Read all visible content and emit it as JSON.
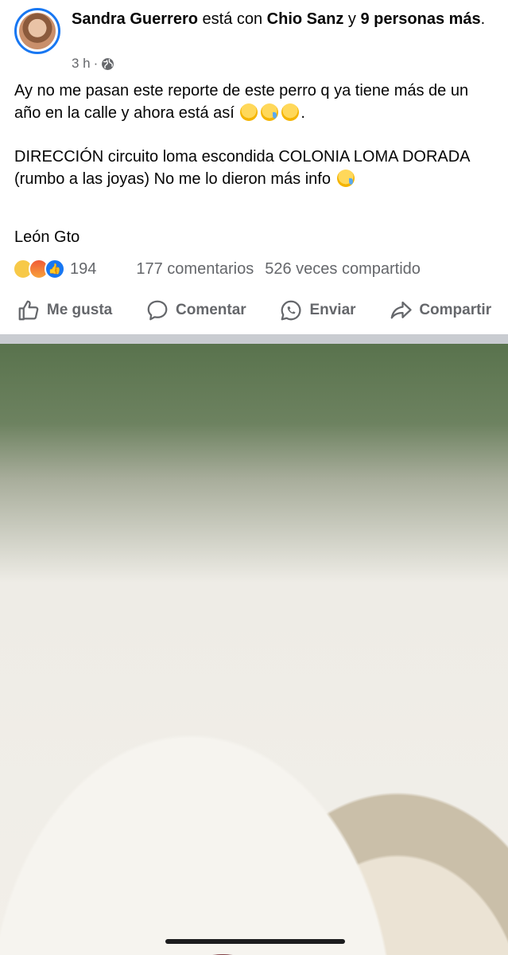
{
  "post": {
    "author": "Sandra Guerrero",
    "with_text": " está con ",
    "tagged": "Chio Sanz",
    "and_text": " y ",
    "others": "9 personas más",
    "period": ".",
    "time": "3 h",
    "dot": "·",
    "text_line1": "Ay no me pasan este reporte de este perro q ya tiene más de un año en la calle y ahora está así",
    "text_end": ".",
    "text_para2": "DIRECCIÓN circuito loma escondida COLONIA  LOMA DORADA (rumbo a las joyas)  No me lo dieron más info",
    "location": "León Gto"
  },
  "stats": {
    "reactions_count": "194",
    "comments": "177 comentarios",
    "shares": "526 veces compartido"
  },
  "actions": {
    "like": "Me gusta",
    "comment": "Comentar",
    "send": "Enviar",
    "share": "Compartir"
  },
  "icons": {
    "globe": "globe-icon",
    "like": "thumbs-up-icon",
    "comment": "comment-bubble-icon",
    "send": "whatsapp-icon",
    "share": "share-arrow-icon"
  },
  "colors": {
    "accent": "#1877f2",
    "secondary_text": "#65676b",
    "divider": "#c9ccd1"
  }
}
